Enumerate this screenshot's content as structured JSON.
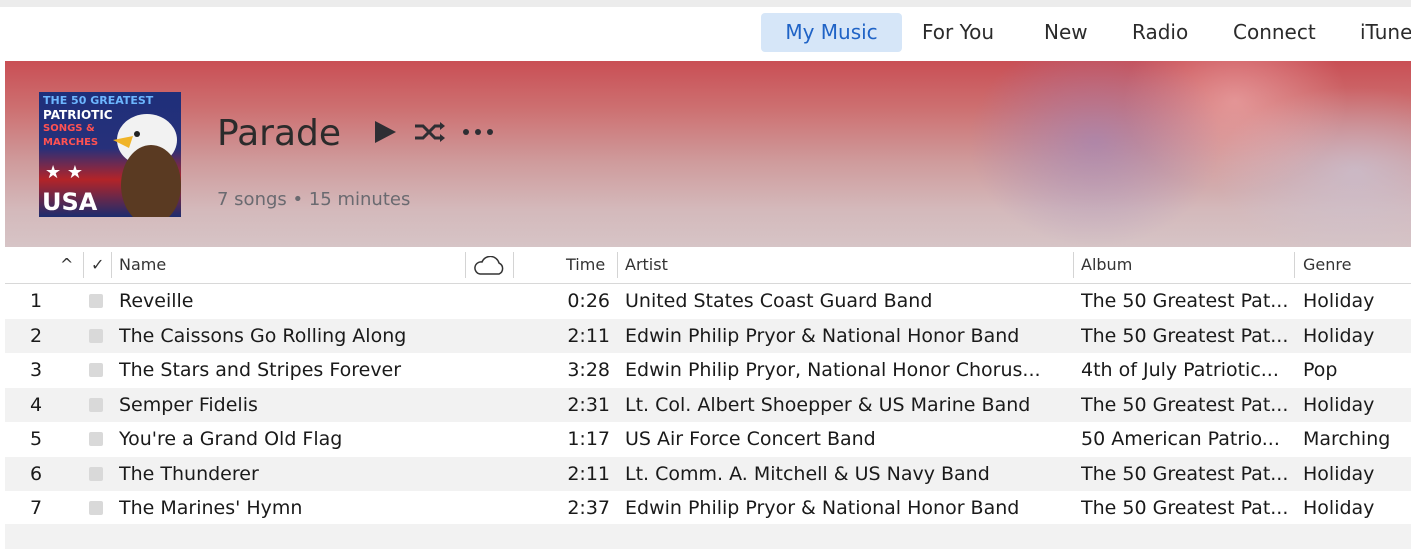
{
  "nav": {
    "tabs": [
      {
        "label": "My Music",
        "active": true
      },
      {
        "label": "For You"
      },
      {
        "label": "New"
      },
      {
        "label": "Radio"
      },
      {
        "label": "Connect"
      },
      {
        "label": "iTune"
      }
    ]
  },
  "playlist": {
    "title": "Parade",
    "summary": "7 songs • 15 minutes",
    "artwork": {
      "line1": "THE 50 GREATEST",
      "line2": "PATRIOTIC",
      "line3": "SONGS &",
      "line4": "MARCHES",
      "line5": "USA"
    }
  },
  "table": {
    "headers": {
      "sort": "^",
      "check": "✓",
      "name": "Name",
      "cloud_icon": "cloud-icon",
      "time": "Time",
      "artist": "Artist",
      "album": "Album",
      "genre": "Genre"
    },
    "rows": [
      {
        "num": "1",
        "name": "Reveille",
        "time": "0:26",
        "artist": "United States Coast Guard Band",
        "album": "The 50 Greatest Pat...",
        "genre": "Holiday"
      },
      {
        "num": "2",
        "name": "The Caissons Go Rolling Along",
        "time": "2:11",
        "artist": "Edwin Philip Pryor & National Honor Band",
        "album": "The 50 Greatest Pat...",
        "genre": "Holiday"
      },
      {
        "num": "3",
        "name": "The Stars and Stripes Forever",
        "time": "3:28",
        "artist": "Edwin Philip Pryor, National Honor Chorus...",
        "album": "4th of July Patriotic...",
        "genre": "Pop"
      },
      {
        "num": "4",
        "name": "Semper Fidelis",
        "time": "2:31",
        "artist": "Lt. Col. Albert Shoepper & US Marine Band",
        "album": "The 50 Greatest Pat...",
        "genre": "Holiday"
      },
      {
        "num": "5",
        "name": "You're a Grand Old Flag",
        "time": "1:17",
        "artist": "US Air Force Concert Band",
        "album": "50 American Patrio...",
        "genre": "Marching"
      },
      {
        "num": "6",
        "name": "The Thunderer",
        "time": "2:11",
        "artist": "Lt. Comm. A. Mitchell & US Navy Band",
        "album": "The 50 Greatest Pat...",
        "genre": "Holiday"
      },
      {
        "num": "7",
        "name": "The Marines' Hymn",
        "time": "2:37",
        "artist": "Edwin Philip Pryor & National Honor Band",
        "album": "The 50 Greatest Pat...",
        "genre": "Holiday"
      }
    ]
  },
  "colors": {
    "accent": "#1f63c6",
    "active_tab_bg": "#d6e6f8",
    "header_red": "#c94f55"
  }
}
